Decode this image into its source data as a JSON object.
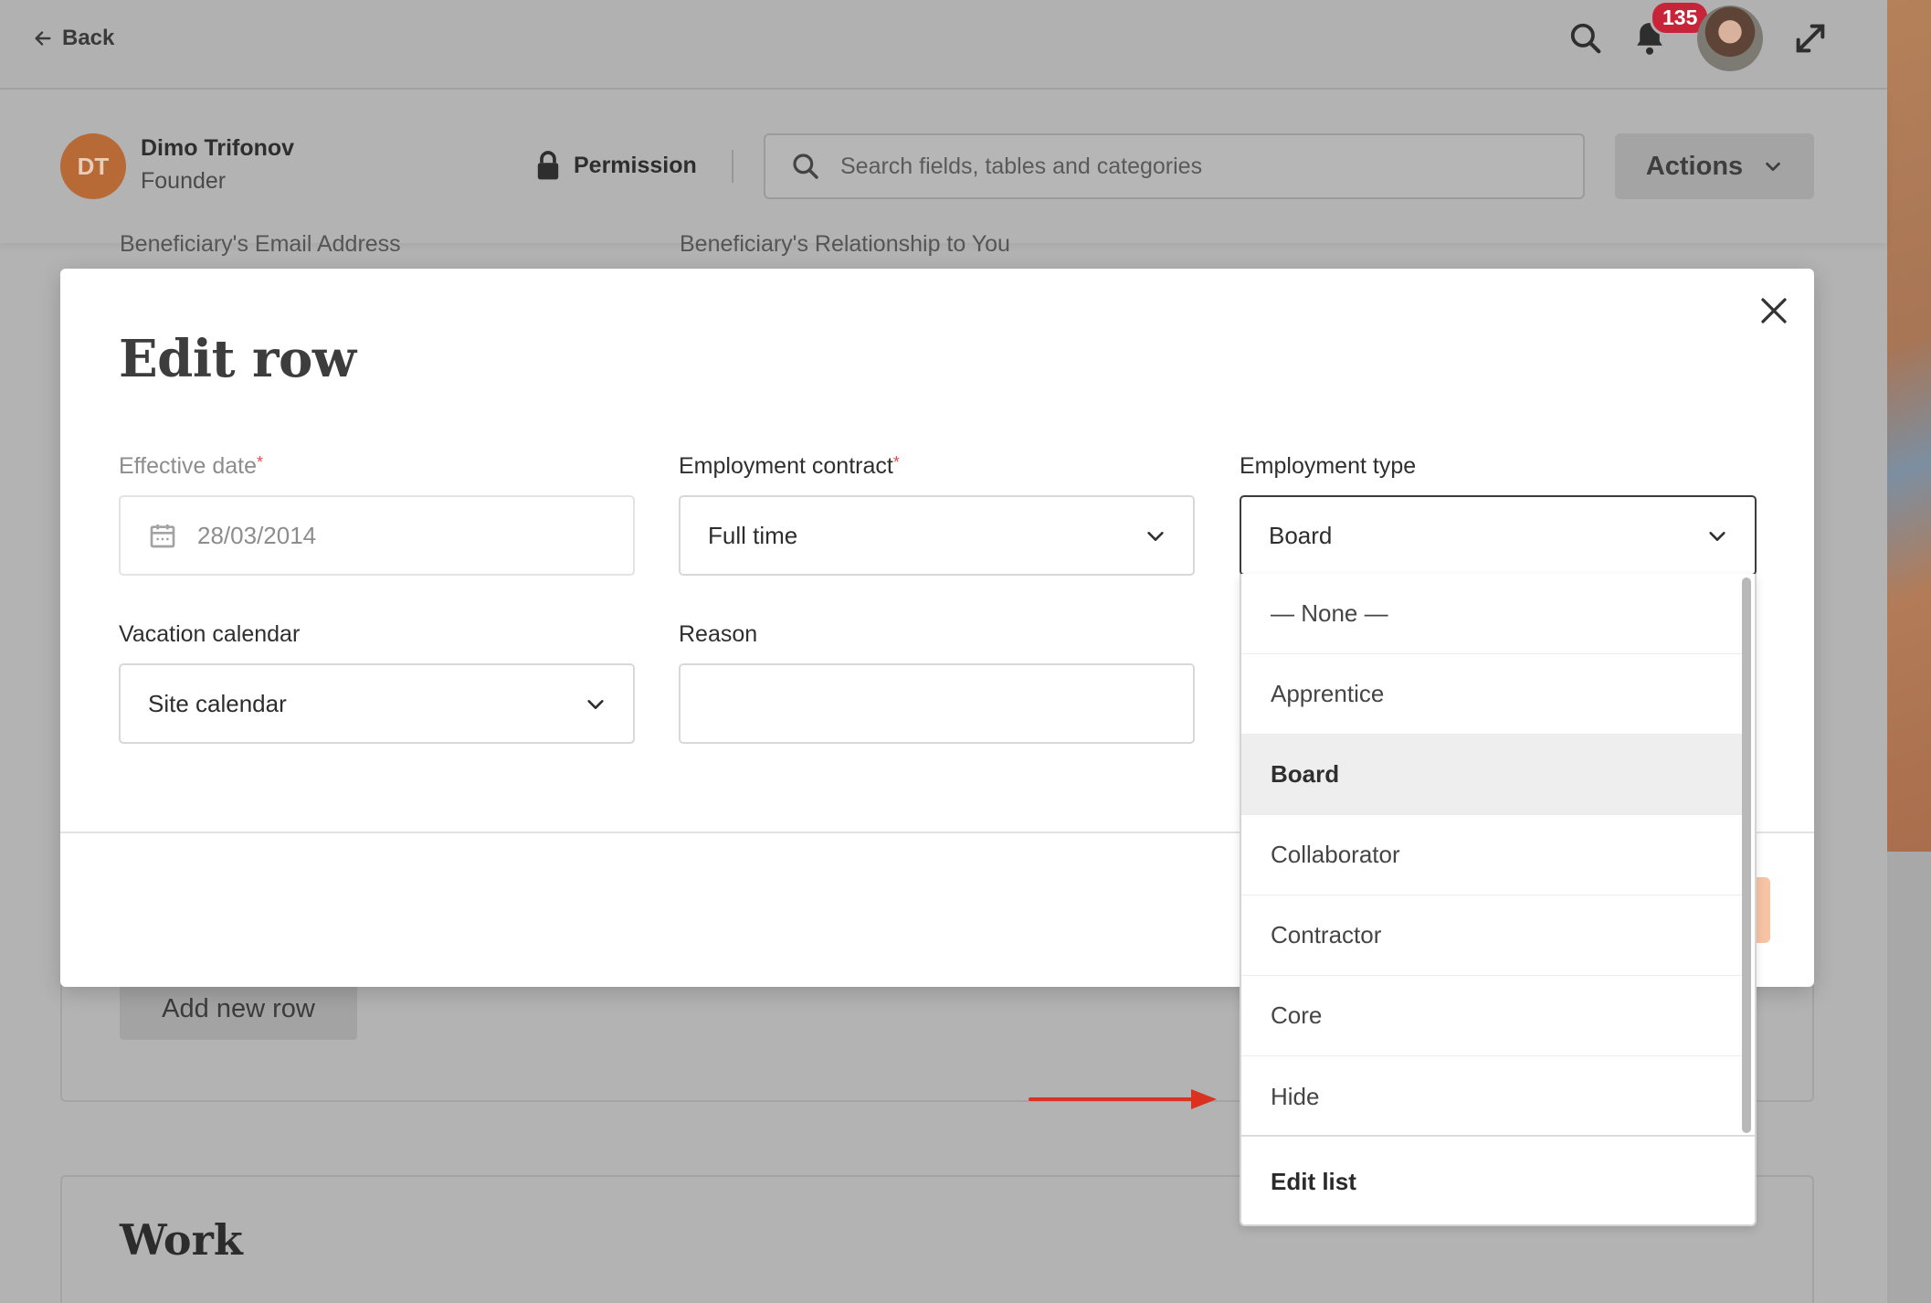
{
  "topbar": {
    "back_label": "Back",
    "notification_count": "135",
    "icons": [
      "search-icon",
      "bell-icon",
      "user-avatar",
      "expand-icon"
    ]
  },
  "profile": {
    "initials": "DT",
    "name": "Dimo Trifonov",
    "role": "Founder",
    "permission_label": "Permission",
    "search_placeholder": "Search fields, tables and categories",
    "actions_label": "Actions"
  },
  "background": {
    "label_email": "Beneficiary's Email Address",
    "label_relationship": "Beneficiary's Relationship to You",
    "add_row_label": "Add new row",
    "section_title": "Work"
  },
  "modal": {
    "title": "Edit row",
    "fields": {
      "effective_date": {
        "label": "Effective date",
        "required_mark": "*",
        "value": "28/03/2014"
      },
      "employment_contract": {
        "label": "Employment contract",
        "required_mark": "*",
        "value": "Full time"
      },
      "employment_type": {
        "label": "Employment type",
        "value": "Board"
      },
      "vacation_calendar": {
        "label": "Vacation calendar",
        "value": "Site calendar"
      },
      "reason": {
        "label": "Reason",
        "value": ""
      }
    }
  },
  "dropdown": {
    "options": [
      "— None —",
      "Apprentice",
      "Board",
      "Collaborator",
      "Contractor",
      "Core",
      "Hide"
    ],
    "selected": "Board",
    "footer_label": "Edit list"
  },
  "colors": {
    "required": "#d9534f",
    "badge": "#c7243a",
    "annotation_arrow": "#d9321f",
    "avatar_bg": "#b86a36"
  }
}
